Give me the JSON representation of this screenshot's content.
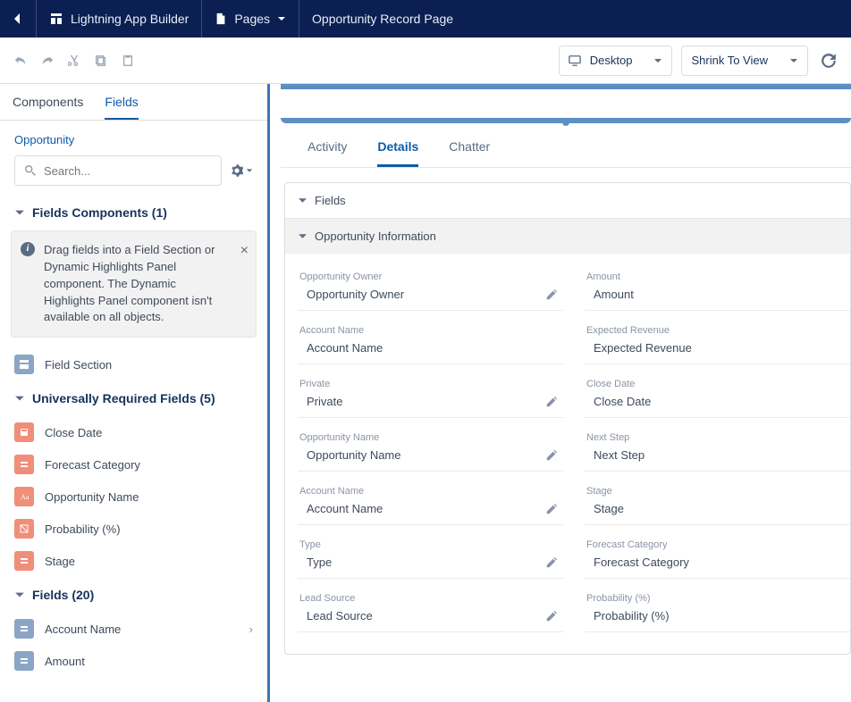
{
  "topbar": {
    "app_label": "Lightning App Builder",
    "pages_label": "Pages",
    "page_title": "Opportunity Record Page"
  },
  "toolbar": {
    "device_label": "Desktop",
    "zoom_label": "Shrink To View"
  },
  "sidebar": {
    "tab_components": "Components",
    "tab_fields": "Fields",
    "crumb": "Opportunity",
    "search_placeholder": "Search...",
    "sec_fields_components": "Fields Components (1)",
    "info_text": "Drag fields into a Field Section or Dynamic Highlights Panel component. The Dynamic Highlights Panel component isn't available on all objects.",
    "field_section_label": "Field Section",
    "sec_required": "Universally Required Fields (5)",
    "required": [
      {
        "label": "Close Date"
      },
      {
        "label": "Forecast Category"
      },
      {
        "label": "Opportunity Name"
      },
      {
        "label": "Probability (%)"
      },
      {
        "label": "Stage"
      }
    ],
    "sec_fields": "Fields (20)",
    "fields": [
      {
        "label": "Account Name"
      },
      {
        "label": "Amount"
      }
    ]
  },
  "canvas": {
    "tab_activity": "Activity",
    "tab_details": "Details",
    "tab_chatter": "Chatter",
    "fields_header": "Fields",
    "oi_header": "Opportunity Information",
    "left": [
      {
        "label": "Opportunity Owner",
        "value": "Opportunity Owner",
        "edit": true
      },
      {
        "label": "Account Name",
        "value": "Account Name",
        "edit": false
      },
      {
        "label": "Private",
        "value": "Private",
        "edit": true
      },
      {
        "label": "Opportunity Name",
        "value": "Opportunity Name",
        "edit": true
      },
      {
        "label": "Account Name",
        "value": "Account Name",
        "edit": true
      },
      {
        "label": "Type",
        "value": "Type",
        "edit": true
      },
      {
        "label": "Lead Source",
        "value": "Lead Source",
        "edit": true
      }
    ],
    "right": [
      {
        "label": "Amount",
        "value": "Amount",
        "edit": false
      },
      {
        "label": "Expected Revenue",
        "value": "Expected Revenue",
        "edit": false
      },
      {
        "label": "Close Date",
        "value": "Close Date",
        "edit": false
      },
      {
        "label": "Next Step",
        "value": "Next Step",
        "edit": false
      },
      {
        "label": "Stage",
        "value": "Stage",
        "edit": false
      },
      {
        "label": "Forecast Category",
        "value": "Forecast Category",
        "edit": false
      },
      {
        "label": "Probability (%)",
        "value": "Probability (%)",
        "edit": false
      }
    ]
  }
}
